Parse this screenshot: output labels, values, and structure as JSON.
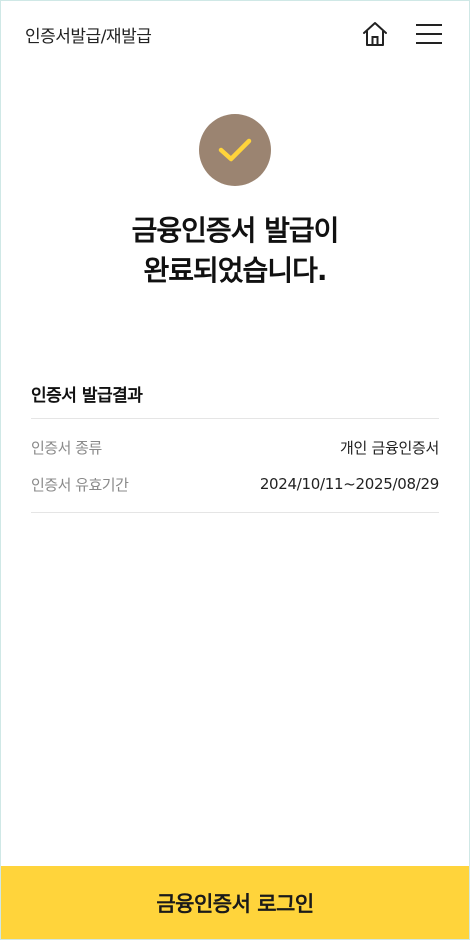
{
  "header": {
    "title": "인증서발급/재발급",
    "home_icon": "home-icon",
    "menu_icon": "hamburger-menu-icon"
  },
  "status": {
    "icon": "check-icon",
    "headline_line1": "금융인증서 발급이",
    "headline_line2": "완료되었습니다."
  },
  "result": {
    "title": "인증서 발급결과",
    "rows": [
      {
        "label": "인증서 종류",
        "value": "개인 금융인증서"
      },
      {
        "label": "인증서 유효기간",
        "value": "2024/10/11~2025/08/29"
      }
    ]
  },
  "cta": {
    "label": "금융인증서 로그인"
  },
  "colors": {
    "accent": "#ffd43b",
    "check_circle": "#9b8471",
    "check_mark": "#ffd43b"
  }
}
